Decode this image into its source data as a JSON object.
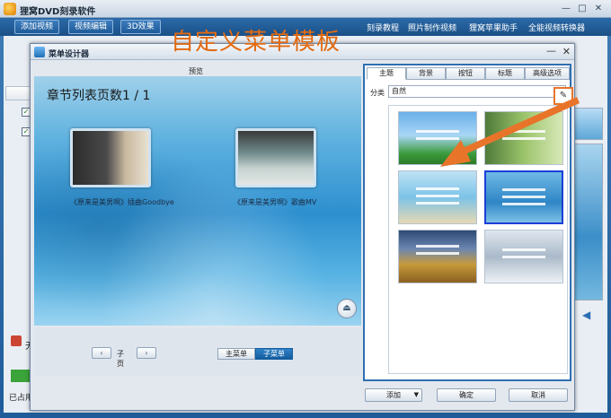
{
  "app": {
    "title": "狸窝DVD刻录软件",
    "toolbar": {
      "add_video": "添加视频",
      "video_edit": "视频编辑",
      "effect_3d": "3D效果",
      "links": [
        "刻录教程",
        "照片制作视频",
        "狸窝苹果助手",
        "全能视频转换器"
      ]
    },
    "window_controls": {
      "minimize": "—",
      "maximize": "□",
      "close": "✕"
    },
    "background": {
      "left_label": "无",
      "bottom_label": "已占用"
    }
  },
  "dialog": {
    "title": "菜单设计器",
    "preview_label": "预览",
    "preview_title": "章节列表页数1 / 1",
    "captions": [
      "《原来是美男啊》插曲Goodbye",
      "《原来是美男啊》歌曲MV"
    ],
    "overlay_text": "自定义菜单模板",
    "subpage_label": "子页",
    "main_menu": "主菜单",
    "sub_menu": "子菜单",
    "tabs": [
      "主题",
      "背景",
      "按钮",
      "标题",
      "高级选项"
    ],
    "active_tab_index": 0,
    "category_label": "分类",
    "category_value": "自然",
    "templates_count": 6,
    "selected_template_index": 3,
    "add_button": "添加",
    "ok_button": "确定",
    "cancel_button": "取消",
    "close_glyph": "✕",
    "min_glyph": "—"
  },
  "colors": {
    "accent_orange": "#e8742a",
    "selected_blue": "#1c3fd6",
    "panel_border": "#2f6fb2"
  }
}
